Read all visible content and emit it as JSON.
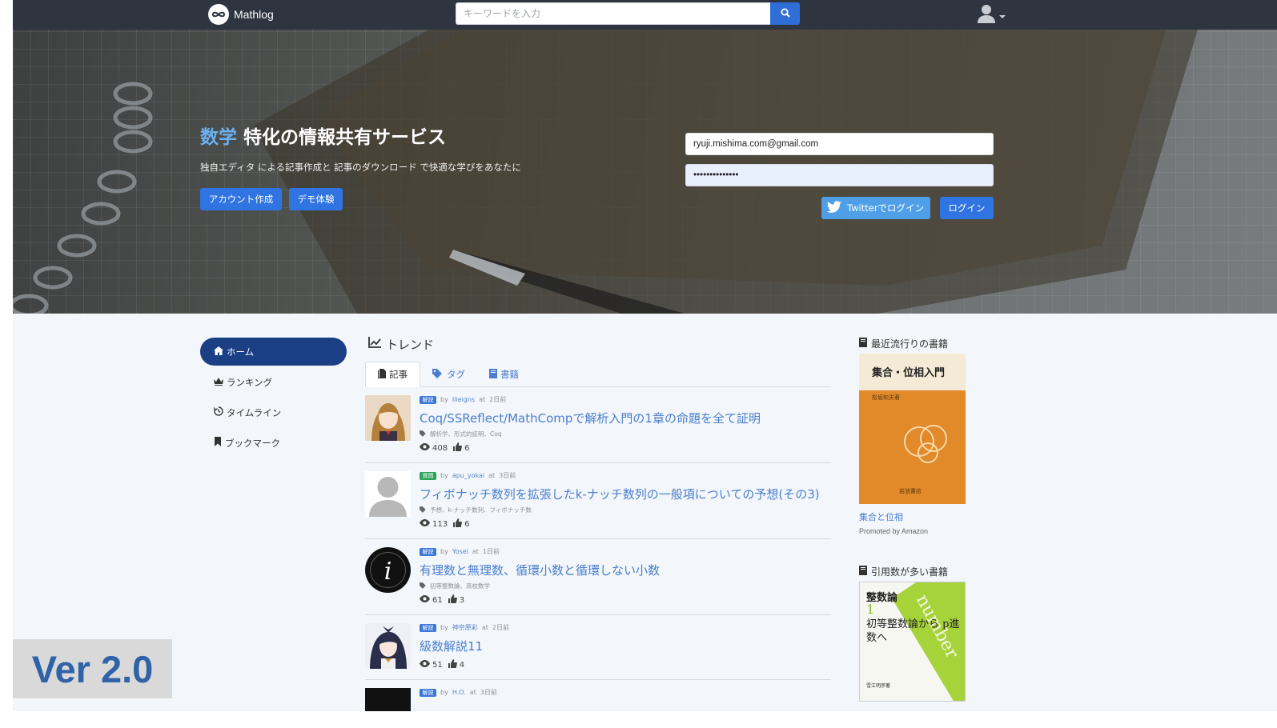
{
  "nav": {
    "brand": "Mathlog",
    "search_placeholder": "キーワードを入力"
  },
  "hero": {
    "title_accent": "数学",
    "title_rest": " 特化の情報共有サービス",
    "subtitle": "独自エディタ による記事作成と 記事のダウンロード で快適な学びをあなたに",
    "signup_label": "アカウント作成",
    "demo_label": "デモ体験",
    "login": {
      "email_value": "ryuji.mishima.com@gmail.com",
      "password_value": "••••••••••••••",
      "twitter_label": "Twitterでログイン",
      "login_label": "ログイン"
    }
  },
  "sidebar": {
    "items": [
      {
        "label": "ホーム",
        "icon": "home-icon",
        "active": true
      },
      {
        "label": "ランキング",
        "icon": "crown-icon",
        "active": false
      },
      {
        "label": "タイムライン",
        "icon": "history-icon",
        "active": false
      },
      {
        "label": "ブックマーク",
        "icon": "bookmark-icon",
        "active": false
      }
    ]
  },
  "main": {
    "heading": "トレンド",
    "tabs": [
      {
        "label": "記事",
        "icon": "file-icon",
        "active": true
      },
      {
        "label": "タグ",
        "icon": "tag-icon",
        "active": false
      },
      {
        "label": "書籍",
        "icon": "book-icon",
        "active": false
      }
    ],
    "articles": [
      {
        "badge": "解説",
        "badge_color": "#3a78d8",
        "author": "Ilieigns",
        "at": "at",
        "time": "2日前",
        "title": "Coq/SSReflect/MathCompで解析入門の1章の命題を全て証明",
        "tags": "解析学、形式的証明、Coq",
        "views": "408",
        "likes": "6",
        "avatar": "anime-girl-brown"
      },
      {
        "badge": "質問",
        "badge_color": "#2aa55a",
        "author": "apu_yokai",
        "at": "at",
        "time": "3日前",
        "title": "フィボナッチ数列を拡張したk-ナッチ数列の一般項についての予想(その3)",
        "tags": "予想、k-ナッチ数列、フィボナッチ数",
        "views": "113",
        "likes": "6",
        "avatar": "default-user"
      },
      {
        "badge": "解説",
        "badge_color": "#3a78d8",
        "author": "Yosei",
        "at": "at",
        "time": "1日前",
        "title": "有理数と無理数、循環小数と循環しない小数",
        "tags": "初等整数論、高校数学",
        "views": "61",
        "likes": "3",
        "avatar": "letter-i"
      },
      {
        "badge": "解説",
        "badge_color": "#3a78d8",
        "author": "神奈原彩",
        "at": "at",
        "time": "2日前",
        "title": "級数解説11",
        "tags": "",
        "views": "51",
        "likes": "4",
        "avatar": "anime-girl-dark"
      },
      {
        "badge": "解説",
        "badge_color": "#3a78d8",
        "author": "H.O.",
        "at": "at",
        "time": "3日前",
        "title": "",
        "tags": "",
        "views": "",
        "likes": "",
        "avatar": "black"
      }
    ]
  },
  "rightcol": {
    "heading1": "最近流行りの書籍",
    "book1": {
      "cover_title": "集合・位相入門",
      "cover_author": "松坂和夫著",
      "cover_publisher": "岩波書店",
      "link": "集合と位相",
      "promoted": "Promoted by Amazon"
    },
    "heading2": "引用数が多い書籍",
    "book2": {
      "cover_title": "整数論",
      "cover_number": "1",
      "cover_subtitle": "初等整数論から p進数へ",
      "cover_band": "number",
      "cover_author": "雪江明彦著"
    }
  },
  "version_label": "Ver 2.0"
}
